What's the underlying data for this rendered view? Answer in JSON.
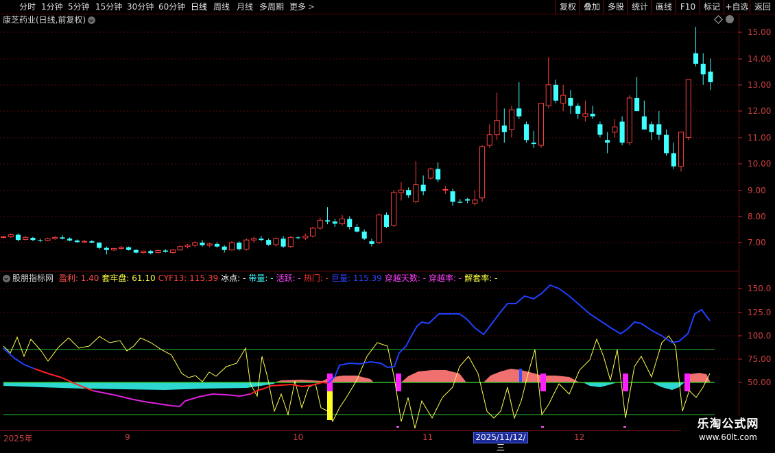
{
  "toolbar": {
    "periods": [
      "分时",
      "1分钟",
      "5分钟",
      "15分钟",
      "30分钟",
      "60分钟",
      "日线",
      "周线",
      "月线",
      "多周期",
      "更多"
    ],
    "active_period": "日线",
    "right_buttons": [
      "复权",
      "叠加",
      "多股",
      "统计",
      "画线",
      "F10",
      "标记",
      "+自选",
      "返回"
    ]
  },
  "main_pane": {
    "title": "康芝药业(日线,前复权)",
    "y_ticks": [
      "15.00",
      "14.00",
      "13.00",
      "12.00",
      "11.00",
      "10.00",
      "9.00",
      "8.00",
      "7.00"
    ]
  },
  "indicator_pane": {
    "name": "股朋指标网",
    "fields": [
      {
        "label": "盈利:",
        "value": "1.40",
        "color": "#ff5050"
      },
      {
        "label": "套牢盘:",
        "value": "61.10",
        "color": "#ffff40"
      },
      {
        "label": "CYF13:",
        "value": "115.39",
        "color": "#ff4040"
      },
      {
        "label": "冰点:",
        "value": "-",
        "color": "#ffffff"
      },
      {
        "label": "带量:",
        "value": "-",
        "color": "#40ffff"
      },
      {
        "label": "活跃:",
        "value": "-",
        "color": "#ff40ff"
      },
      {
        "label": "热门:",
        "value": "-",
        "color": "#ff3030"
      },
      {
        "label": "巨量:",
        "value": "115.39",
        "color": "#3040ff"
      },
      {
        "label": "穿越天数:",
        "value": "-",
        "color": "#ff40ff"
      },
      {
        "label": "穿越率:",
        "value": "-",
        "color": "#ff40ff"
      },
      {
        "label": "解套率:",
        "value": "-",
        "color": "#ffff40"
      }
    ],
    "y_ticks": [
      "150.0",
      "125.0",
      "100.0",
      "75.00",
      "50.00"
    ]
  },
  "x_axis": {
    "labels": [
      "2025年",
      "9",
      "10",
      "11",
      "12"
    ],
    "highlight_date": "2025/11/12/三"
  },
  "watermark": {
    "line1": "乐淘公式网",
    "line2": "www.60lt.com"
  },
  "colors": {
    "up": "#ff4040",
    "down": "#40ffff",
    "panel_border": "#7a1010"
  },
  "chart_data": {
    "type": "candlestick",
    "ylim": [
      6.6,
      15.3
    ],
    "candles": [
      [
        7.2,
        7.25,
        7.15,
        7.22
      ],
      [
        7.22,
        7.35,
        7.18,
        7.3
      ],
      [
        7.3,
        7.35,
        7.05,
        7.1
      ],
      [
        7.12,
        7.25,
        7.08,
        7.2
      ],
      [
        7.18,
        7.22,
        7.05,
        7.1
      ],
      [
        7.1,
        7.15,
        7.02,
        7.08
      ],
      [
        7.08,
        7.18,
        7.05,
        7.15
      ],
      [
        7.15,
        7.25,
        7.1,
        7.2
      ],
      [
        7.2,
        7.28,
        7.12,
        7.15
      ],
      [
        7.15,
        7.2,
        7.05,
        7.08
      ],
      [
        7.08,
        7.12,
        6.98,
        7.02
      ],
      [
        7.02,
        7.1,
        6.98,
        7.05
      ],
      [
        7.05,
        7.1,
        6.98,
        7.0
      ],
      [
        7.0,
        7.02,
        6.75,
        6.8
      ],
      [
        6.8,
        6.85,
        6.55,
        6.72
      ],
      [
        6.72,
        6.8,
        6.68,
        6.78
      ],
      [
        6.78,
        6.88,
        6.72,
        6.82
      ],
      [
        6.82,
        6.85,
        6.7,
        6.72
      ],
      [
        6.72,
        6.75,
        6.58,
        6.62
      ],
      [
        6.62,
        6.7,
        6.58,
        6.68
      ],
      [
        6.68,
        6.72,
        6.55,
        6.6
      ],
      [
        6.62,
        6.72,
        6.58,
        6.7
      ],
      [
        6.7,
        6.75,
        6.62,
        6.65
      ],
      [
        6.62,
        6.75,
        6.58,
        6.72
      ],
      [
        6.72,
        6.9,
        6.7,
        6.85
      ],
      [
        6.85,
        6.95,
        6.78,
        6.9
      ],
      [
        6.9,
        7.05,
        6.82,
        7.0
      ],
      [
        7.0,
        7.1,
        6.85,
        6.9
      ],
      [
        6.9,
        7.0,
        6.82,
        6.95
      ],
      [
        6.95,
        7.02,
        6.8,
        6.85
      ],
      [
        6.85,
        6.9,
        6.62,
        6.72
      ],
      [
        6.72,
        7.05,
        6.7,
        7.0
      ],
      [
        7.0,
        7.05,
        6.7,
        6.75
      ],
      [
        6.75,
        7.15,
        6.7,
        7.1
      ],
      [
        7.1,
        7.22,
        7.0,
        7.15
      ],
      [
        7.15,
        7.25,
        7.05,
        7.1
      ],
      [
        7.1,
        7.15,
        6.88,
        6.92
      ],
      [
        6.92,
        7.2,
        6.85,
        7.15
      ],
      [
        7.15,
        7.25,
        6.8,
        6.85
      ],
      [
        6.85,
        7.25,
        6.8,
        7.2
      ],
      [
        7.2,
        7.25,
        7.12,
        7.18
      ],
      [
        7.18,
        7.35,
        7.1,
        7.25
      ],
      [
        7.25,
        7.6,
        7.2,
        7.55
      ],
      [
        7.55,
        7.95,
        7.5,
        7.85
      ],
      [
        7.85,
        8.35,
        7.7,
        7.8
      ],
      [
        7.8,
        7.9,
        7.6,
        7.72
      ],
      [
        7.72,
        8.05,
        7.65,
        7.9
      ],
      [
        7.9,
        8.0,
        7.5,
        7.6
      ],
      [
        7.6,
        7.7,
        7.38,
        7.42
      ],
      [
        7.42,
        7.5,
        7.1,
        7.15
      ],
      [
        7.05,
        7.15,
        6.85,
        6.95
      ],
      [
        7.0,
        8.1,
        6.95,
        8.05
      ],
      [
        8.05,
        8.15,
        7.55,
        7.6
      ],
      [
        7.65,
        9.0,
        7.6,
        8.9
      ],
      [
        8.9,
        9.3,
        8.6,
        9.0
      ],
      [
        9.0,
        9.1,
        8.7,
        8.8
      ],
      [
        8.55,
        10.1,
        8.5,
        9.2
      ],
      [
        9.2,
        9.55,
        8.8,
        8.95
      ],
      [
        9.45,
        9.85,
        9.4,
        9.8
      ],
      [
        9.8,
        10.05,
        9.3,
        9.4
      ],
      [
        9.0,
        9.15,
        8.85,
        9.02
      ],
      [
        8.95,
        9.05,
        8.4,
        8.55
      ],
      [
        8.55,
        8.65,
        8.5,
        8.52
      ],
      [
        8.65,
        8.7,
        8.5,
        8.6
      ],
      [
        8.5,
        9.0,
        8.4,
        8.62
      ],
      [
        8.7,
        10.7,
        8.55,
        10.65
      ],
      [
        10.7,
        11.5,
        10.6,
        11.1
      ],
      [
        11.1,
        12.7,
        10.9,
        11.65
      ],
      [
        11.45,
        12.1,
        10.8,
        11.2
      ],
      [
        11.3,
        12.2,
        11.0,
        12.05
      ],
      [
        12.1,
        13.1,
        11.7,
        11.8
      ],
      [
        11.5,
        11.6,
        10.8,
        10.9
      ],
      [
        10.8,
        11.25,
        10.6,
        10.75
      ],
      [
        10.7,
        12.3,
        10.6,
        12.3
      ],
      [
        12.2,
        14.05,
        12.1,
        13.0
      ],
      [
        13.0,
        13.2,
        12.3,
        12.4
      ],
      [
        12.3,
        13.0,
        12.0,
        12.6
      ],
      [
        12.5,
        12.8,
        11.9,
        12.2
      ],
      [
        12.2,
        12.3,
        11.7,
        11.9
      ],
      [
        11.8,
        12.4,
        11.6,
        11.9
      ],
      [
        11.9,
        12.2,
        11.7,
        11.8
      ],
      [
        11.5,
        11.6,
        11.0,
        11.1
      ],
      [
        10.9,
        11.2,
        10.4,
        10.8
      ],
      [
        11.2,
        11.7,
        11.0,
        11.4
      ],
      [
        11.6,
        11.8,
        10.7,
        10.8
      ],
      [
        10.8,
        12.6,
        10.7,
        12.5
      ],
      [
        12.5,
        13.3,
        12.1,
        12.0
      ],
      [
        11.8,
        12.4,
        11.4,
        11.3
      ],
      [
        11.5,
        11.6,
        10.9,
        11.2
      ],
      [
        11.5,
        12.0,
        10.9,
        11.1
      ],
      [
        11.1,
        11.3,
        10.3,
        10.4
      ],
      [
        10.4,
        10.8,
        9.8,
        9.9
      ],
      [
        9.9,
        10.9,
        9.7,
        11.2
      ],
      [
        11.0,
        13.2,
        10.9,
        13.2
      ],
      [
        14.2,
        15.2,
        13.7,
        13.8
      ],
      [
        13.8,
        14.2,
        13.0,
        13.4
      ],
      [
        13.5,
        14.0,
        12.8,
        13.1
      ]
    ]
  }
}
